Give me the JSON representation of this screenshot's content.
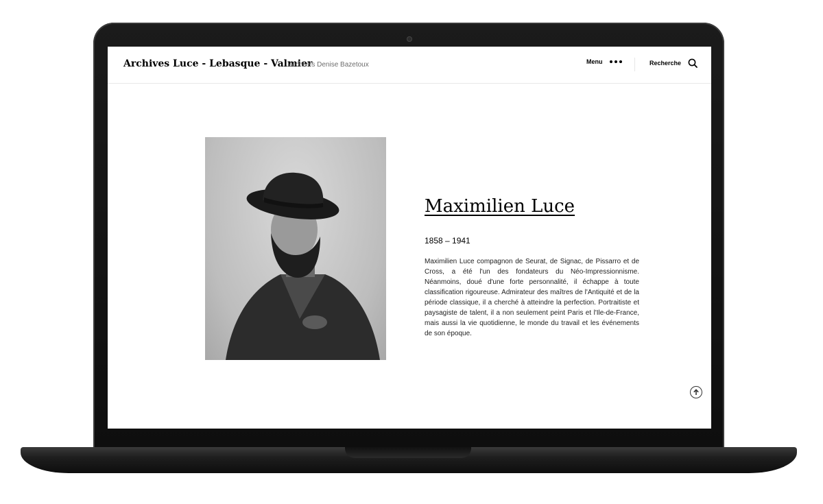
{
  "header": {
    "site_title": "Archives Luce - Lebasque - Valmier",
    "site_description": "Archives Denise Bazetoux",
    "menu_label": "Menu",
    "search_label": "Recherche"
  },
  "artist": {
    "name": "Maximilien Luce",
    "dates": "1858 – 1941",
    "bio": "Maximilien Luce compagnon de Seurat, de Signac, de Pissarro et de Cross, a été l'un des fondateurs du Néo-Impressionnisme. Néanmoins, doué d'une forte personnalité, il échappe à toute classification rigoureuse. Admirateur des maîtres de l'Antiquité et de la période classique, il a cherché à atteindre la perfection. Portraitiste et paysagiste de talent, il a non seulement peint Paris et l'Ile-de-France, mais aussi la vie quotidienne, le monde du travail et les événements de son époque."
  },
  "icons": {
    "menu": "more-dots-icon",
    "search": "search-icon",
    "scroll_top": "arrow-up-circle-icon"
  },
  "colors": {
    "text": "#000000",
    "muted": "#6d6d6d",
    "frame": "#111111"
  }
}
